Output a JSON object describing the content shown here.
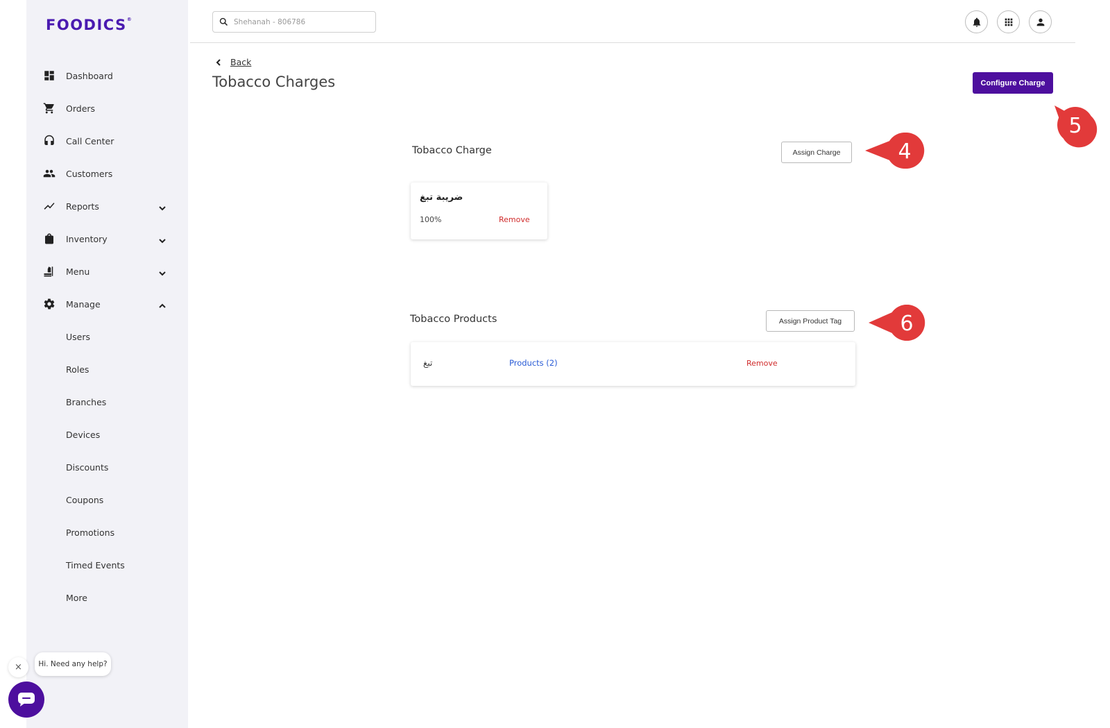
{
  "brand": {
    "logo_text": "FOODICS",
    "accent_color": "#4d0f9e",
    "logo_color": "#4a1ab0"
  },
  "sidebar": {
    "items": [
      {
        "label": "Dashboard",
        "icon": "dashboard-icon"
      },
      {
        "label": "Orders",
        "icon": "cart-icon"
      },
      {
        "label": "Call Center",
        "icon": "headset-icon"
      },
      {
        "label": "Customers",
        "icon": "people-icon"
      },
      {
        "label": "Reports",
        "icon": "trend-icon",
        "expandable": true
      },
      {
        "label": "Inventory",
        "icon": "bag-icon",
        "expandable": true
      },
      {
        "label": "Menu",
        "icon": "menu-food-icon",
        "expandable": true
      },
      {
        "label": "Manage",
        "icon": "gear-icon",
        "expanded": true
      }
    ],
    "manage_sub_items": [
      "Users",
      "Roles",
      "Branches",
      "Devices",
      "Discounts",
      "Coupons",
      "Promotions",
      "Timed Events",
      "More"
    ]
  },
  "header": {
    "search_placeholder": "Shehanah - 806786",
    "icons": [
      "bell-icon",
      "apps-grid-icon",
      "user-icon"
    ]
  },
  "page": {
    "back_label": "Back",
    "title": "Tobacco Charges",
    "configure_button": "Configure Charge"
  },
  "tobacco_charge": {
    "section_title": "Tobacco Charge",
    "assign_button": "Assign Charge",
    "charge": {
      "name": "ضريبة تبغ",
      "value": "100%",
      "remove_label": "Remove"
    }
  },
  "tobacco_products": {
    "section_title": "Tobacco Products",
    "assign_button": "Assign Product Tag",
    "tag": {
      "name": "تبغ",
      "products_label": "Products (2)",
      "remove_label": "Remove"
    }
  },
  "annotations": {
    "marker_4": "4",
    "marker_5": "5",
    "marker_6": "6",
    "color": "#e23a3a"
  },
  "chat": {
    "greeting": "Hi. Need any help?",
    "close_symbol": "×"
  }
}
